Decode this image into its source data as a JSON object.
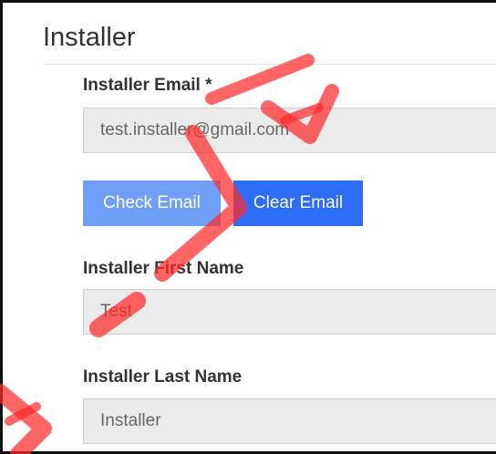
{
  "section": {
    "title": "Installer"
  },
  "form": {
    "email": {
      "label": "Installer Email *",
      "value": "test.installer@gmail.com"
    },
    "check_email_label": "Check Email",
    "clear_email_label": "Clear Email",
    "first_name": {
      "label": "Installer First Name",
      "value": "Test"
    },
    "last_name": {
      "label": "Installer Last Name",
      "value": "Installer"
    }
  },
  "colors": {
    "check_button": "#6f9ff6",
    "clear_button": "#2d6df5",
    "input_background": "#ebebeb",
    "watermark": "#ff2a2a"
  },
  "watermark": {
    "text": "A-VIA"
  }
}
